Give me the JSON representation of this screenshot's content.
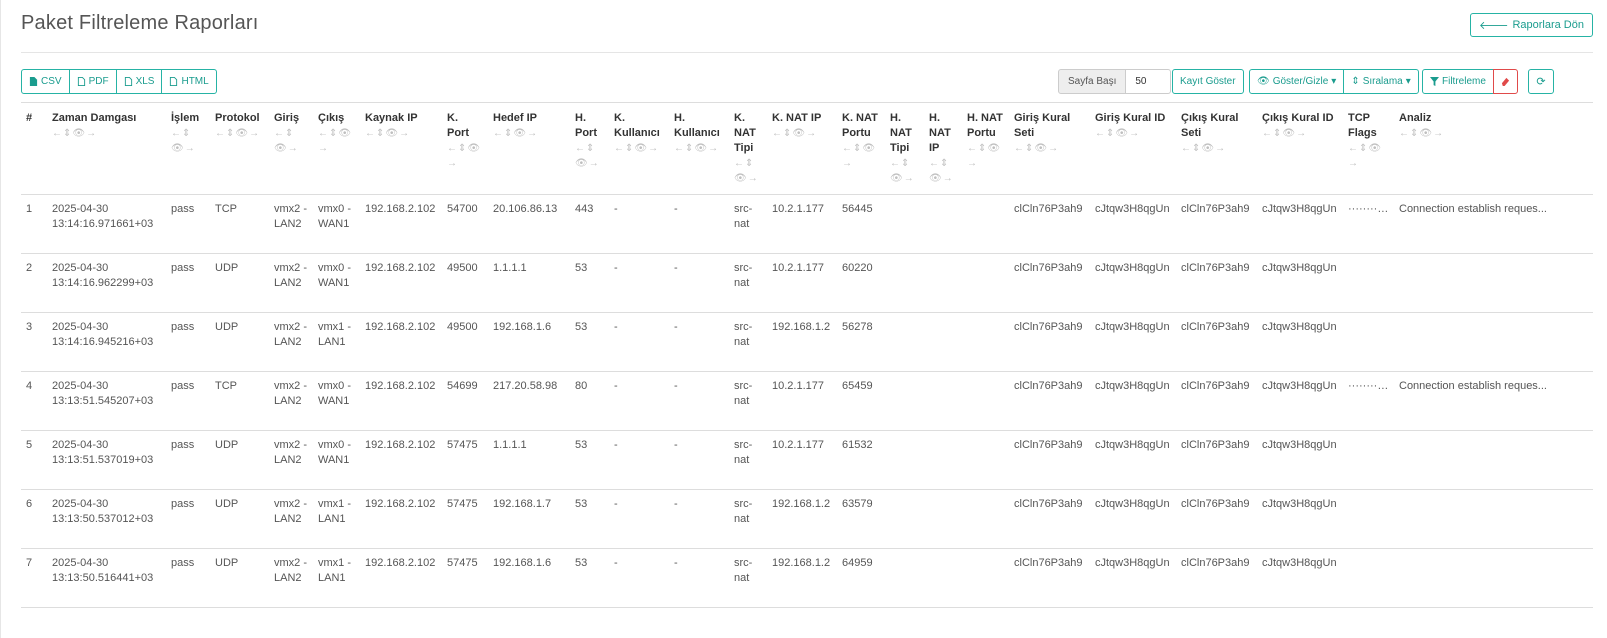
{
  "page": {
    "title": "Paket Filtreleme Raporları",
    "back_label": "Raporlara Dön"
  },
  "toolbar": {
    "export": [
      "CSV",
      "PDF",
      "XLS",
      "HTML"
    ],
    "per_page_label": "Sayfa Başı",
    "per_page_value": "50",
    "show_records": "Kayıt Göster",
    "show_hide": "Göster/Gizle",
    "sort": "Sıralama",
    "filter": "Filtreleme"
  },
  "columns": [
    "#",
    "Zaman Damgası",
    "İşlem",
    "Protokol",
    "Giriş",
    "Çıkış",
    "Kaynak IP",
    "K. Port",
    "Hedef IP",
    "H. Port",
    "K. Kullanıcı",
    "H. Kullanıcı",
    "K. NAT Tipi",
    "K. NAT IP",
    "K. NAT Portu",
    "H. NAT Tipi",
    "H. NAT IP",
    "H. NAT Portu",
    "Giriş Kural Seti",
    "Giriş Kural ID",
    "Çıkış Kural Seti",
    "Çıkış Kural ID",
    "TCP Flags",
    "Analiz"
  ],
  "column_controls": "←⇕👁→",
  "rows": [
    [
      "1",
      "2025-04-30 13:14:16.971661+03",
      "pass",
      "TCP",
      "vmx2 - LAN2",
      "vmx0 - WAN1",
      "192.168.2.102",
      "54700",
      "20.106.86.13",
      "443",
      "-",
      "-",
      "src-nat",
      "10.2.1.177",
      "56445",
      "",
      "",
      "",
      "clCln76P3ah9",
      "cJtqw3H8qgUn",
      "clCln76P3ah9",
      "cJtqw3H8qgUn",
      "·········S·",
      "Connection establish reques..."
    ],
    [
      "2",
      "2025-04-30 13:14:16.962299+03",
      "pass",
      "UDP",
      "vmx2 - LAN2",
      "vmx0 - WAN1",
      "192.168.2.102",
      "49500",
      "1.1.1.1",
      "53",
      "-",
      "-",
      "src-nat",
      "10.2.1.177",
      "60220",
      "",
      "",
      "",
      "clCln76P3ah9",
      "cJtqw3H8qgUn",
      "clCln76P3ah9",
      "cJtqw3H8qgUn",
      "",
      ""
    ],
    [
      "3",
      "2025-04-30 13:14:16.945216+03",
      "pass",
      "UDP",
      "vmx2 - LAN2",
      "vmx1 - LAN1",
      "192.168.2.102",
      "49500",
      "192.168.1.6",
      "53",
      "-",
      "-",
      "src-nat",
      "192.168.1.2",
      "56278",
      "",
      "",
      "",
      "clCln76P3ah9",
      "cJtqw3H8qgUn",
      "clCln76P3ah9",
      "cJtqw3H8qgUn",
      "",
      ""
    ],
    [
      "4",
      "2025-04-30 13:13:51.545207+03",
      "pass",
      "TCP",
      "vmx2 - LAN2",
      "vmx0 - WAN1",
      "192.168.2.102",
      "54699",
      "217.20.58.98",
      "80",
      "-",
      "-",
      "src-nat",
      "10.2.1.177",
      "65459",
      "",
      "",
      "",
      "clCln76P3ah9",
      "cJtqw3H8qgUn",
      "clCln76P3ah9",
      "cJtqw3H8qgUn",
      "·········S·",
      "Connection establish reques..."
    ],
    [
      "5",
      "2025-04-30 13:13:51.537019+03",
      "pass",
      "UDP",
      "vmx2 - LAN2",
      "vmx0 - WAN1",
      "192.168.2.102",
      "57475",
      "1.1.1.1",
      "53",
      "-",
      "-",
      "src-nat",
      "10.2.1.177",
      "61532",
      "",
      "",
      "",
      "clCln76P3ah9",
      "cJtqw3H8qgUn",
      "clCln76P3ah9",
      "cJtqw3H8qgUn",
      "",
      ""
    ],
    [
      "6",
      "2025-04-30 13:13:50.537012+03",
      "pass",
      "UDP",
      "vmx2 - LAN2",
      "vmx1 - LAN1",
      "192.168.2.102",
      "57475",
      "192.168.1.7",
      "53",
      "-",
      "-",
      "src-nat",
      "192.168.1.2",
      "63579",
      "",
      "",
      "",
      "clCln76P3ah9",
      "cJtqw3H8qgUn",
      "clCln76P3ah9",
      "cJtqw3H8qgUn",
      "",
      ""
    ],
    [
      "7",
      "2025-04-30 13:13:50.516441+03",
      "pass",
      "UDP",
      "vmx2 - LAN2",
      "vmx1 - LAN1",
      "192.168.2.102",
      "57475",
      "192.168.1.6",
      "53",
      "-",
      "-",
      "src-nat",
      "192.168.1.2",
      "64959",
      "",
      "",
      "",
      "clCln76P3ah9",
      "cJtqw3H8qgUn",
      "clCln76P3ah9",
      "cJtqw3H8qgUn",
      "",
      ""
    ]
  ],
  "colors": {
    "accent": "#26b3a5",
    "danger": "#e04a4a"
  }
}
